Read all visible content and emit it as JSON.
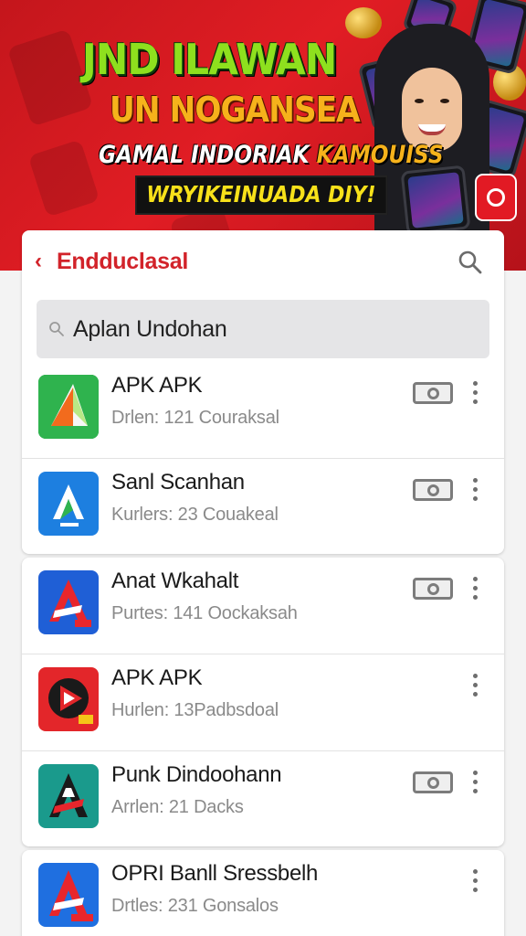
{
  "banner": {
    "line1": "JND ILAWAN",
    "line2": "UN NOGANSEA",
    "line3a": "GAMAL INDORIAK",
    "line3b": "KAMOUISS",
    "line4": "WRYIKEINUADA DIY!"
  },
  "header": {
    "back_symbol": "‹",
    "title": "Endduclasal"
  },
  "search": {
    "value": "Aplan Undohan"
  },
  "apps": [
    {
      "name": "APK APK",
      "meta": "Drlen: 121 Couraksal",
      "icon": "apk-green-triangle-icon",
      "has_download": true
    },
    {
      "name": "Sanl Scanhan",
      "meta": "Kurlers: 23 Couakeal",
      "icon": "blue-a-logo-icon",
      "has_download": true
    },
    {
      "name": "Anat Wkahalt",
      "meta": "Purtes: 141 Oockaksah",
      "icon": "red-a-logo-icon",
      "has_download": true
    },
    {
      "name": "APK APK",
      "meta": "Hurlen: 13Padbsdoal",
      "icon": "red-play-logo-icon",
      "has_download": false
    },
    {
      "name": "Punk Dindoohann",
      "meta": "Arrlen: 21 Dacks",
      "icon": "teal-a-logo-icon",
      "has_download": true
    },
    {
      "name": "OPRI Banll Sressbelh",
      "meta": "Drtles: 231 Gonsalos",
      "icon": "blue-red-a-logo-icon",
      "has_download": false
    }
  ],
  "colors": {
    "accent": "#d2232a",
    "banner_red": "#e11d24"
  }
}
